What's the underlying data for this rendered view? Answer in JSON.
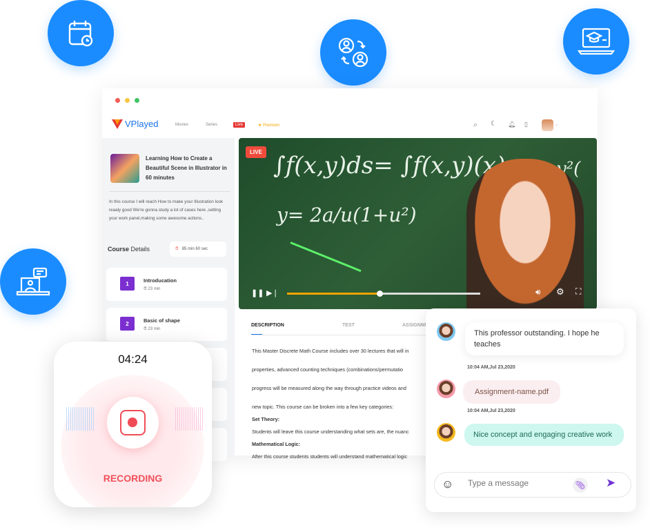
{
  "brand": {
    "name": "VPlayed",
    "accent": "#1a8cff"
  },
  "header": {
    "nav": [
      "Movies",
      "Series",
      "Live",
      "Premium"
    ]
  },
  "course": {
    "title": "Learning How to Create a Beautiful Scene in Illustrator in 60 minutes",
    "intro": "In this course I will reach How to make your Illustration look reaaly good We're gonna study a lot of cases here ,setting your work panel,making some awesome actions..",
    "details_label_bold": "Course",
    "details_label": " Details",
    "duration": "85 min 60 sec",
    "lessons": [
      {
        "num": "1",
        "title": "Introducation",
        "duration": "23 min"
      },
      {
        "num": "2",
        "title": "Basic of shape",
        "duration": "23 min"
      }
    ]
  },
  "video": {
    "live_badge": "LIVE",
    "progress": 0.48
  },
  "tabs": [
    "DESCRIPTION",
    "TEST",
    "ASSIGNMENT"
  ],
  "description": [
    "This Master Discrete Math Course includes over 30 lectures that will in",
    "properties, advanced counting techniques (combinations/permutatio",
    "progress will be measured along the way through practice videos and",
    "new topic. This course can be broken into a few key categories:",
    "Set Theory:",
    "Students will leave this course understanding what sets are, the nuanc",
    "Mathematical Logic:",
    "After this course students students will understand mathematical logic"
  ],
  "recording": {
    "time": "04:24",
    "label": "RECORDING"
  },
  "chat": {
    "messages": [
      {
        "text": "This professor outstanding. I hope he teaches",
        "time": "10:04 AM,Jul 23,2020"
      },
      {
        "text": "Assignment-name.pdf",
        "time": "10:04 AM,Jul 23,2020"
      },
      {
        "text": "Nice concept and engaging creative work"
      }
    ],
    "placeholder": "Type a message"
  }
}
